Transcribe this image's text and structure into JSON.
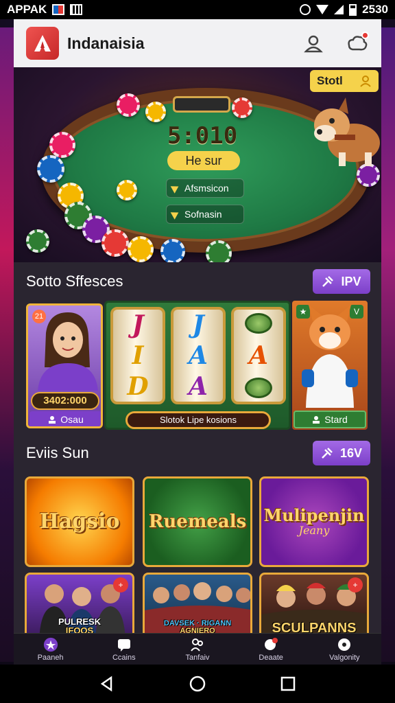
{
  "status_bar": {
    "carrier": "APPAK",
    "time": "2530",
    "icons": [
      "flag-icon",
      "grid-icon",
      "alarm-icon",
      "wifi-icon",
      "signal-icon",
      "battery-icon"
    ]
  },
  "header": {
    "title": "Indanaisia",
    "logo_icon": "app-logo-icon",
    "actions": [
      "profile-icon",
      "settings-icon"
    ],
    "colors": {
      "brand": "#d32f2f",
      "background": "#f1f1f3"
    }
  },
  "hero": {
    "timer": "5:010",
    "pill": "He sur",
    "menu": [
      "Afsmsicon",
      "Sofnasin"
    ],
    "slot_button": "Stotl",
    "colors": {
      "felt": "#1f7a45",
      "accent": "#f5d24b"
    }
  },
  "section1": {
    "title": "Sotto Sffesces",
    "button": "IPV",
    "card_left": {
      "badge": "21",
      "amount": "3402:000",
      "button": "Osau"
    },
    "slot": {
      "reels": [
        [
          "J",
          "I",
          "D"
        ],
        [
          "J",
          "A",
          "A"
        ],
        [
          "leaf",
          "A",
          "leaf"
        ]
      ],
      "caption": "Slotok Lipe kosions"
    },
    "card_right": {
      "badge": "V",
      "button": "Stard"
    }
  },
  "section2": {
    "title": "Eviis Sun",
    "button": "16V",
    "tiles": [
      {
        "title": "Hagsio",
        "sub": ""
      },
      {
        "title": "Ruemeals",
        "sub": ""
      },
      {
        "title": "Mulipenjin",
        "sub": "Jeany"
      }
    ],
    "people_tiles": [
      {
        "caption_line1": "PULRESK",
        "caption_line2": "IFOOS",
        "badge": "+"
      },
      {
        "caption_line1": "DAVSEK · RIGANN",
        "caption_line2": "AGNIERO",
        "badge": ""
      },
      {
        "caption_line1": "SCULPANNS",
        "caption_line2": "",
        "badge": "+"
      }
    ]
  },
  "tab_bar": {
    "items": [
      {
        "label": "Paaneh",
        "icon": "star-icon"
      },
      {
        "label": "Ccains",
        "icon": "chat-icon"
      },
      {
        "label": "Tanfaiv",
        "icon": "people-icon"
      },
      {
        "label": "Deaate",
        "icon": "message-icon"
      },
      {
        "label": "Valgonity",
        "icon": "record-icon"
      }
    ]
  },
  "nav_bar": {
    "buttons": [
      "back-icon",
      "home-icon",
      "recents-icon"
    ]
  }
}
